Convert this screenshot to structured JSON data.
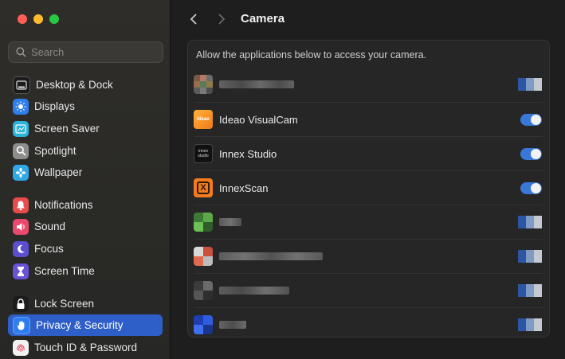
{
  "window": {
    "title": "Camera"
  },
  "search": {
    "placeholder": "Search"
  },
  "sidebar": {
    "items": [
      {
        "label": "Desktop & Dock",
        "icon": "dock-icon",
        "color": "#1b1b1b"
      },
      {
        "label": "Displays",
        "icon": "sun-icon",
        "color": "#2f7ef0"
      },
      {
        "label": "Screen Saver",
        "icon": "screen-saver-icon",
        "color": "#2bb3d9"
      },
      {
        "label": "Spotlight",
        "icon": "magnifier-icon",
        "color": "#8d8d8d"
      },
      {
        "label": "Wallpaper",
        "icon": "flower-icon",
        "color": "#32a8e6"
      },
      {
        "label": "Notifications",
        "icon": "bell-icon",
        "color": "#e94b4b"
      },
      {
        "label": "Sound",
        "icon": "speaker-icon",
        "color": "#e8496d"
      },
      {
        "label": "Focus",
        "icon": "moon-icon",
        "color": "#5b4fcf"
      },
      {
        "label": "Screen Time",
        "icon": "hourglass-icon",
        "color": "#6a52d6"
      },
      {
        "label": "Lock Screen",
        "icon": "lock-icon",
        "color": "#1b1b1b"
      },
      {
        "label": "Privacy & Security",
        "icon": "hand-icon",
        "color": "#2f7ef0",
        "active": true
      },
      {
        "label": "Touch ID & Password",
        "icon": "fingerprint-icon",
        "color": "#f2f2f2"
      }
    ]
  },
  "main": {
    "description": "Allow the applications below to access your camera.",
    "apps": [
      {
        "name": "",
        "blurred": true,
        "enabled": true
      },
      {
        "name": "Ideao VisualCam",
        "blurred": false,
        "enabled": true,
        "icon_label": "Ideao"
      },
      {
        "name": "Innex Studio",
        "blurred": false,
        "enabled": true,
        "icon_label": "innex studio"
      },
      {
        "name": "InnexScan",
        "blurred": false,
        "enabled": true,
        "icon_label": "X"
      },
      {
        "name": "",
        "blurred": true,
        "enabled": true
      },
      {
        "name": "",
        "blurred": true,
        "enabled": true
      },
      {
        "name": "",
        "blurred": true,
        "enabled": true
      },
      {
        "name": "",
        "blurred": true,
        "enabled": true
      }
    ]
  },
  "colors": {
    "accent": "#2e5ec7",
    "toggle_on": "#3a78d8"
  }
}
